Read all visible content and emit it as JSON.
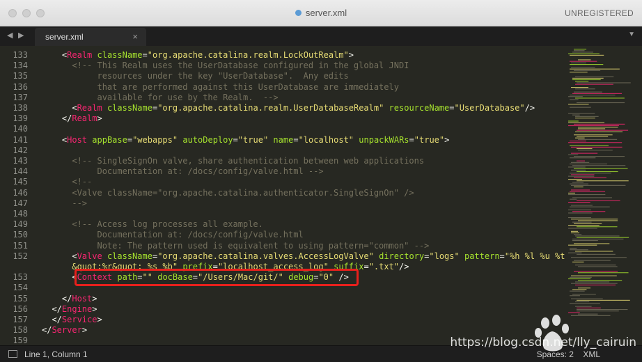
{
  "window": {
    "title": "server.xml",
    "license_text": "UNREGISTERED"
  },
  "tabs": [
    {
      "label": "server.xml",
      "close_icon": "×"
    }
  ],
  "nav": {
    "back": "◀",
    "forward": "▶",
    "tab_menu": "▼"
  },
  "editor": {
    "lines": [
      {
        "no": "133",
        "tokens": [
          [
            "t",
            "    "
          ],
          [
            "t",
            "<"
          ],
          [
            "tag",
            "Realm"
          ],
          [
            "t",
            " "
          ],
          [
            "attr",
            "className"
          ],
          [
            "t",
            "="
          ],
          [
            "str",
            "\"org.apache.catalina.realm.LockOutRealm\""
          ],
          [
            "t",
            ">"
          ]
        ]
      },
      {
        "no": "134",
        "tokens": [
          [
            "com",
            "      <!-- This Realm uses the UserDatabase configured in the global JNDI"
          ]
        ]
      },
      {
        "no": "135",
        "tokens": [
          [
            "com",
            "           resources under the key \"UserDatabase\".  Any edits"
          ]
        ]
      },
      {
        "no": "136",
        "tokens": [
          [
            "com",
            "           that are performed against this UserDatabase are immediately"
          ]
        ]
      },
      {
        "no": "137",
        "tokens": [
          [
            "com",
            "           available for use by the Realm.  -->"
          ]
        ]
      },
      {
        "no": "138",
        "tokens": [
          [
            "t",
            "      <"
          ],
          [
            "tag",
            "Realm"
          ],
          [
            "t",
            " "
          ],
          [
            "attr",
            "className"
          ],
          [
            "t",
            "="
          ],
          [
            "str",
            "\"org.apache.catalina.realm.UserDatabaseRealm\""
          ],
          [
            "t",
            " "
          ],
          [
            "attr",
            "resourceName"
          ],
          [
            "t",
            "="
          ],
          [
            "str",
            "\"UserDatabase\""
          ],
          [
            "t",
            "/>"
          ]
        ]
      },
      {
        "no": "139",
        "tokens": [
          [
            "t",
            "    </"
          ],
          [
            "tag",
            "Realm"
          ],
          [
            "t",
            ">"
          ]
        ]
      },
      {
        "no": "140",
        "tokens": []
      },
      {
        "no": "141",
        "tokens": [
          [
            "t",
            "    <"
          ],
          [
            "tag",
            "Host"
          ],
          [
            "t",
            " "
          ],
          [
            "attr",
            "appBase"
          ],
          [
            "t",
            "="
          ],
          [
            "str",
            "\"webapps\""
          ],
          [
            "t",
            " "
          ],
          [
            "attr",
            "autoDeploy"
          ],
          [
            "t",
            "="
          ],
          [
            "str",
            "\"true\""
          ],
          [
            "t",
            " "
          ],
          [
            "attr",
            "name"
          ],
          [
            "t",
            "="
          ],
          [
            "str",
            "\"localhost\""
          ],
          [
            "t",
            " "
          ],
          [
            "attr",
            "unpackWARs"
          ],
          [
            "t",
            "="
          ],
          [
            "str",
            "\"true\""
          ],
          [
            "t",
            ">"
          ]
        ]
      },
      {
        "no": "142",
        "tokens": []
      },
      {
        "no": "143",
        "tokens": [
          [
            "com",
            "      <!-- SingleSignOn valve, share authentication between web applications"
          ]
        ]
      },
      {
        "no": "144",
        "tokens": [
          [
            "com",
            "           Documentation at: /docs/config/valve.html -->"
          ]
        ]
      },
      {
        "no": "145",
        "tokens": [
          [
            "com",
            "      <!--"
          ]
        ]
      },
      {
        "no": "146",
        "tokens": [
          [
            "com",
            "      <Valve className=\"org.apache.catalina.authenticator.SingleSignOn\" />"
          ]
        ]
      },
      {
        "no": "147",
        "tokens": [
          [
            "com",
            "      -->"
          ]
        ]
      },
      {
        "no": "148",
        "tokens": []
      },
      {
        "no": "149",
        "tokens": [
          [
            "com",
            "      <!-- Access log processes all example."
          ]
        ]
      },
      {
        "no": "150",
        "tokens": [
          [
            "com",
            "           Documentation at: /docs/config/valve.html"
          ]
        ]
      },
      {
        "no": "151",
        "tokens": [
          [
            "com",
            "           Note: The pattern used is equivalent to using pattern=\"common\" -->"
          ]
        ]
      },
      {
        "no": "152",
        "tokens": [
          [
            "t",
            "      <"
          ],
          [
            "tag",
            "Valve"
          ],
          [
            "t",
            " "
          ],
          [
            "attr",
            "className"
          ],
          [
            "t",
            "="
          ],
          [
            "str",
            "\"org.apache.catalina.valves.AccessLogValve\""
          ],
          [
            "t",
            " "
          ],
          [
            "attr",
            "directory"
          ],
          [
            "t",
            "="
          ],
          [
            "str",
            "\"logs\""
          ],
          [
            "t",
            " "
          ],
          [
            "attr",
            "pattern"
          ],
          [
            "t",
            "="
          ],
          [
            "str",
            "\"%h %l %u %t"
          ]
        ]
      },
      {
        "no": "",
        "tokens": [
          [
            "str",
            "      &quot;%r&quot; %s %b\""
          ],
          [
            "t",
            " "
          ],
          [
            "attr",
            "prefix"
          ],
          [
            "t",
            "="
          ],
          [
            "str",
            "\"localhost_access_log\""
          ],
          [
            "t",
            " "
          ],
          [
            "attr",
            "suffix"
          ],
          [
            "t",
            "="
          ],
          [
            "str",
            "\".txt\""
          ],
          [
            "t",
            "/>"
          ]
        ]
      },
      {
        "no": "153",
        "tokens": [
          [
            "t",
            "      <"
          ],
          [
            "tag",
            "Context"
          ],
          [
            "t",
            " "
          ],
          [
            "attr",
            "path"
          ],
          [
            "t",
            "="
          ],
          [
            "str",
            "\"\""
          ],
          [
            "t",
            " "
          ],
          [
            "attr",
            "docBase"
          ],
          [
            "t",
            "="
          ],
          [
            "str",
            "\"/Users/Mac/git/\""
          ],
          [
            "t",
            " "
          ],
          [
            "attr",
            "debug"
          ],
          [
            "t",
            "="
          ],
          [
            "str",
            "\"0\""
          ],
          [
            "t",
            " />"
          ]
        ]
      },
      {
        "no": "154",
        "tokens": []
      },
      {
        "no": "155",
        "tokens": [
          [
            "t",
            "    </"
          ],
          [
            "tag",
            "Host"
          ],
          [
            "t",
            ">"
          ]
        ]
      },
      {
        "no": "156",
        "tokens": [
          [
            "t",
            "  </"
          ],
          [
            "tag",
            "Engine"
          ],
          [
            "t",
            ">"
          ]
        ]
      },
      {
        "no": "157",
        "tokens": [
          [
            "t",
            "  </"
          ],
          [
            "tag",
            "Service"
          ],
          [
            "t",
            ">"
          ]
        ]
      },
      {
        "no": "158",
        "tokens": [
          [
            "t",
            "</"
          ],
          [
            "tag",
            "Server"
          ],
          [
            "t",
            ">"
          ]
        ]
      },
      {
        "no": "159",
        "tokens": []
      }
    ]
  },
  "status": {
    "position": "Line 1, Column 1",
    "spaces": "Spaces: 2",
    "syntax": "XML"
  },
  "watermark": "https://blog.csdn.net/lly_cairuin",
  "colors": {
    "tag": "#f92672",
    "attribute": "#a6e22e",
    "string": "#e6db74",
    "comment": "#75715e",
    "highlight_border": "#e8201c"
  }
}
